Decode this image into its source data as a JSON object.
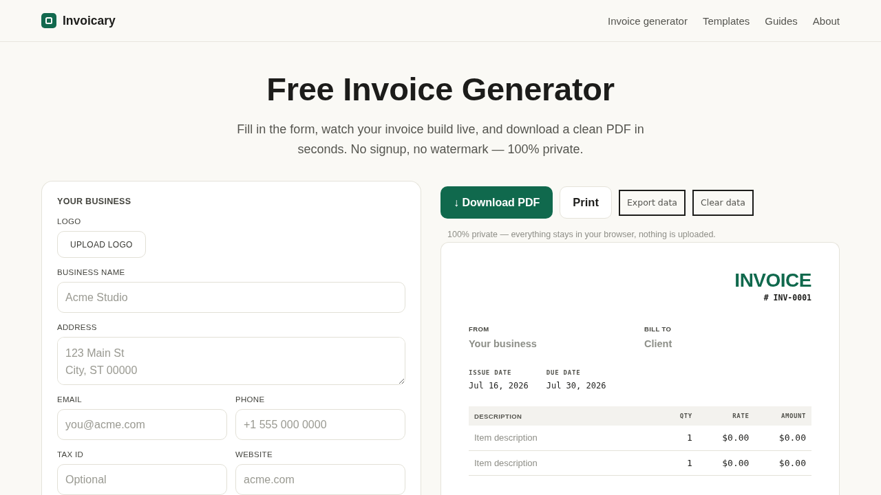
{
  "header": {
    "brand": "Invoicary",
    "nav": [
      "Invoice generator",
      "Templates",
      "Guides",
      "About"
    ]
  },
  "hero": {
    "title": "Free Invoice Generator",
    "subtitle": "Fill in the form, watch your invoice build live, and download a clean PDF in seconds. No signup, no watermark — 100% private."
  },
  "form": {
    "section_title": "YOUR BUSINESS",
    "logo": {
      "label": "LOGO",
      "button": "UPLOAD LOGO"
    },
    "rows": [
      [
        {
          "kind": "text",
          "label": "BUSINESS NAME",
          "placeholder": "Acme Studio"
        }
      ],
      [
        {
          "kind": "textarea",
          "label": "ADDRESS",
          "placeholder": "123 Main St\nCity, ST 00000"
        }
      ],
      [
        {
          "kind": "text",
          "label": "EMAIL",
          "placeholder": "you@acme.com"
        },
        {
          "kind": "text",
          "label": "PHONE",
          "placeholder": "+1 555 000 0000"
        }
      ],
      [
        {
          "kind": "text",
          "label": "TAX ID",
          "placeholder": "Optional"
        },
        {
          "kind": "text",
          "label": "WEBSITE",
          "placeholder": "acme.com"
        }
      ]
    ]
  },
  "actions": {
    "buttons": [
      {
        "kind": "primary",
        "label": "↓ Download PDF"
      },
      {
        "kind": "secondary",
        "label": "Print"
      },
      {
        "kind": "plain",
        "label": "Export data"
      },
      {
        "kind": "plain",
        "label": "Clear data"
      }
    ],
    "note": "100% private — everything stays in your browser, nothing is uploaded."
  },
  "preview": {
    "title": "INVOICE",
    "number": "# INV-0001",
    "parties": [
      {
        "label": "FROM",
        "value": "Your business"
      },
      {
        "label": "BILL TO",
        "value": "Client"
      }
    ],
    "dates": [
      {
        "label": "ISSUE DATE",
        "value": "Jul 16, 2026"
      },
      {
        "label": "DUE DATE",
        "value": "Jul 30, 2026"
      }
    ],
    "table": {
      "columns": [
        "DESCRIPTION",
        "QTY",
        "RATE",
        "AMOUNT"
      ],
      "rows": [
        [
          "Item description",
          "1",
          "$0.00",
          "$0.00"
        ],
        [
          "Item description",
          "1",
          "$0.00",
          "$0.00"
        ]
      ]
    }
  }
}
